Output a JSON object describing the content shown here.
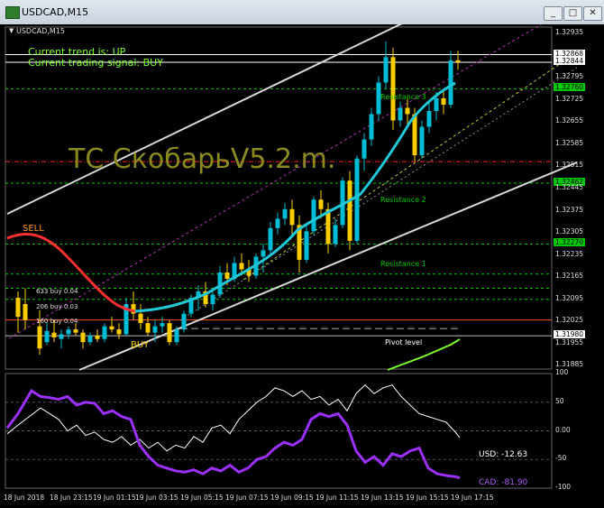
{
  "window": {
    "title": "USDCAD,M15",
    "btn_minimize": "_",
    "btn_restore": "□",
    "btn_close": "✕"
  },
  "chart": {
    "symbol_label": "USDCAD,M15",
    "trend_text": "Current trend is: UP",
    "signal_text": "Current trading signal: BUY",
    "watermark": "ТС СкобарьV5.2.m.",
    "sell_label": "SELL",
    "buy_label": "BUY",
    "pivot_label": "Pivot level",
    "resistance": [
      "Resistance 3",
      "Resistance 2",
      "Resistance 1"
    ],
    "orders": [
      "633 buy 0.04",
      "206 buy 0.03",
      "160 buy 0.04"
    ],
    "prices": [
      "1.32935",
      "1.32868",
      "1.32844",
      "1.32795",
      "1.32760",
      "1.32725",
      "1.32655",
      "1.32585",
      "1.32515",
      "1.32462",
      "1.32445",
      "1.32375",
      "1.32305",
      "1.32270",
      "1.32235",
      "1.32165",
      "1.32095",
      "1.32025",
      "1.31980",
      "1.31955",
      "1.31885"
    ],
    "highlight_prices": {
      "1.32760": "#00c800",
      "1.32462": "#00c800",
      "1.32270": "#00c800",
      "1.31980": "#ffffff",
      "1.32868": "#ffffff",
      "1.32844": "#ffffff"
    },
    "osc_axis": [
      "100",
      "50",
      "0.00",
      "-50",
      "-100"
    ],
    "usd_label": "USD: -12.63",
    "cad_label": "CAD: -81.90",
    "time_labels": [
      "18 Jun 2018",
      "18 Jun 23:15",
      "19 Jun 01:15",
      "19 Jun 03:15",
      "19 Jun 05:15",
      "19 Jun 07:15",
      "19 Jun 09:15",
      "19 Jun 11:15",
      "19 Jun 13:15",
      "19 Jun 15:15",
      "19 Jun 17:15"
    ],
    "colors": {
      "bull": "#00bcd4",
      "bear": "#ffcc00",
      "ma": "#20c8d8",
      "red_line": "#ff3030",
      "cad": "#9b30ff",
      "usd": "#ffffff",
      "channel": "#d8d8d8",
      "pivot": "#7cff2a"
    }
  }
}
